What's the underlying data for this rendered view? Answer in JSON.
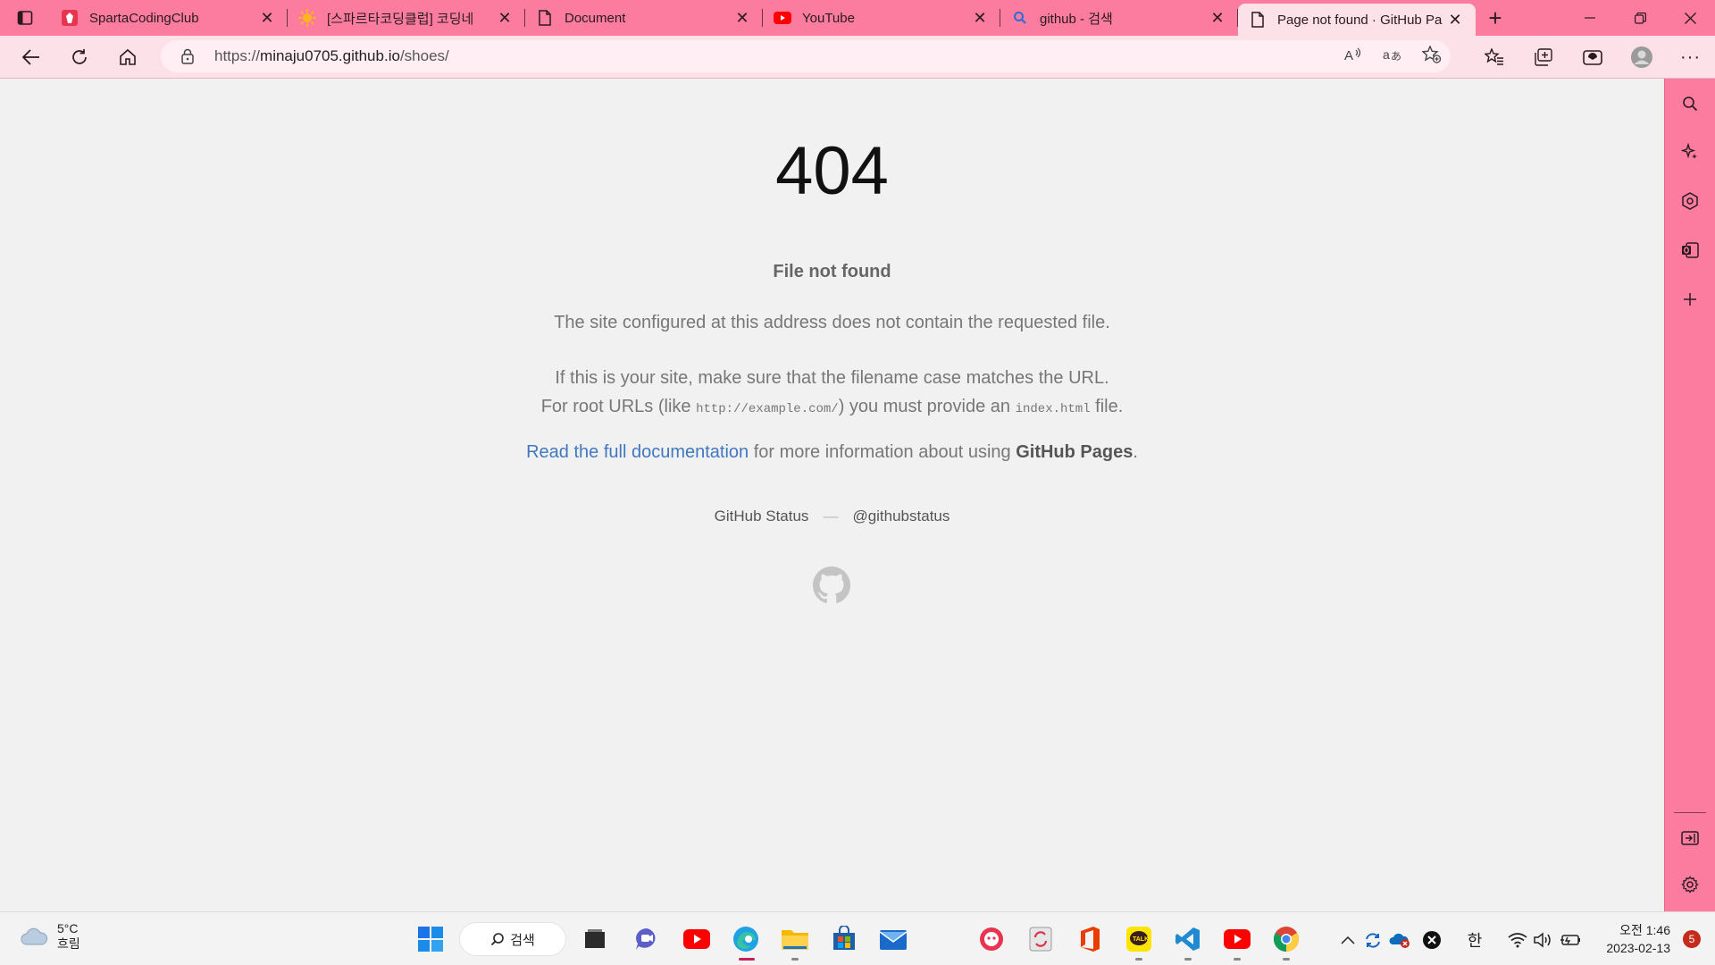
{
  "browser": {
    "tabs": [
      {
        "title": "SpartaCodingClub",
        "icon": "sparta-logo-icon",
        "active": false
      },
      {
        "title": "[스파르타코딩클럽] 코딩네",
        "icon": "sun-icon",
        "active": false
      },
      {
        "title": "Document",
        "icon": "page-icon",
        "active": false
      },
      {
        "title": "YouTube",
        "icon": "youtube-icon",
        "active": false
      },
      {
        "title": "github - 검색",
        "icon": "search-icon",
        "active": false
      },
      {
        "title": "Page not found · GitHub Pa",
        "icon": "page-icon",
        "active": true
      }
    ],
    "url": {
      "prefix": "https://",
      "host": "minaju0705.github.io",
      "path": "/shoes/"
    },
    "accent": "#fb7c9e",
    "toolbar_bg": "#fde1e8"
  },
  "page": {
    "code": "404",
    "heading": "File not found",
    "p1": "The site configured at this address does not contain the requested file.",
    "p2_line1": "If this is your site, make sure that the filename case matches the URL.",
    "p2_pre": "For root URLs (like ",
    "p2_code1": "http://example.com/",
    "p2_mid": ") you must provide an ",
    "p2_code2": "index.html",
    "p2_post": " file.",
    "p3_link": "Read the full documentation",
    "p3_mid": " for more information about using ",
    "p3_bold": "GitHub Pages",
    "p3_end": ".",
    "footer_status": "GitHub Status",
    "footer_dash": "—",
    "footer_twitter": "@githubstatus",
    "link_color": "#4078c0"
  },
  "taskbar": {
    "weather_temp": "5°C",
    "weather_desc": "흐림",
    "search_label": "검색",
    "ime": "한",
    "time": "오전 1:46",
    "date": "2023-02-13",
    "notifications": "5"
  }
}
